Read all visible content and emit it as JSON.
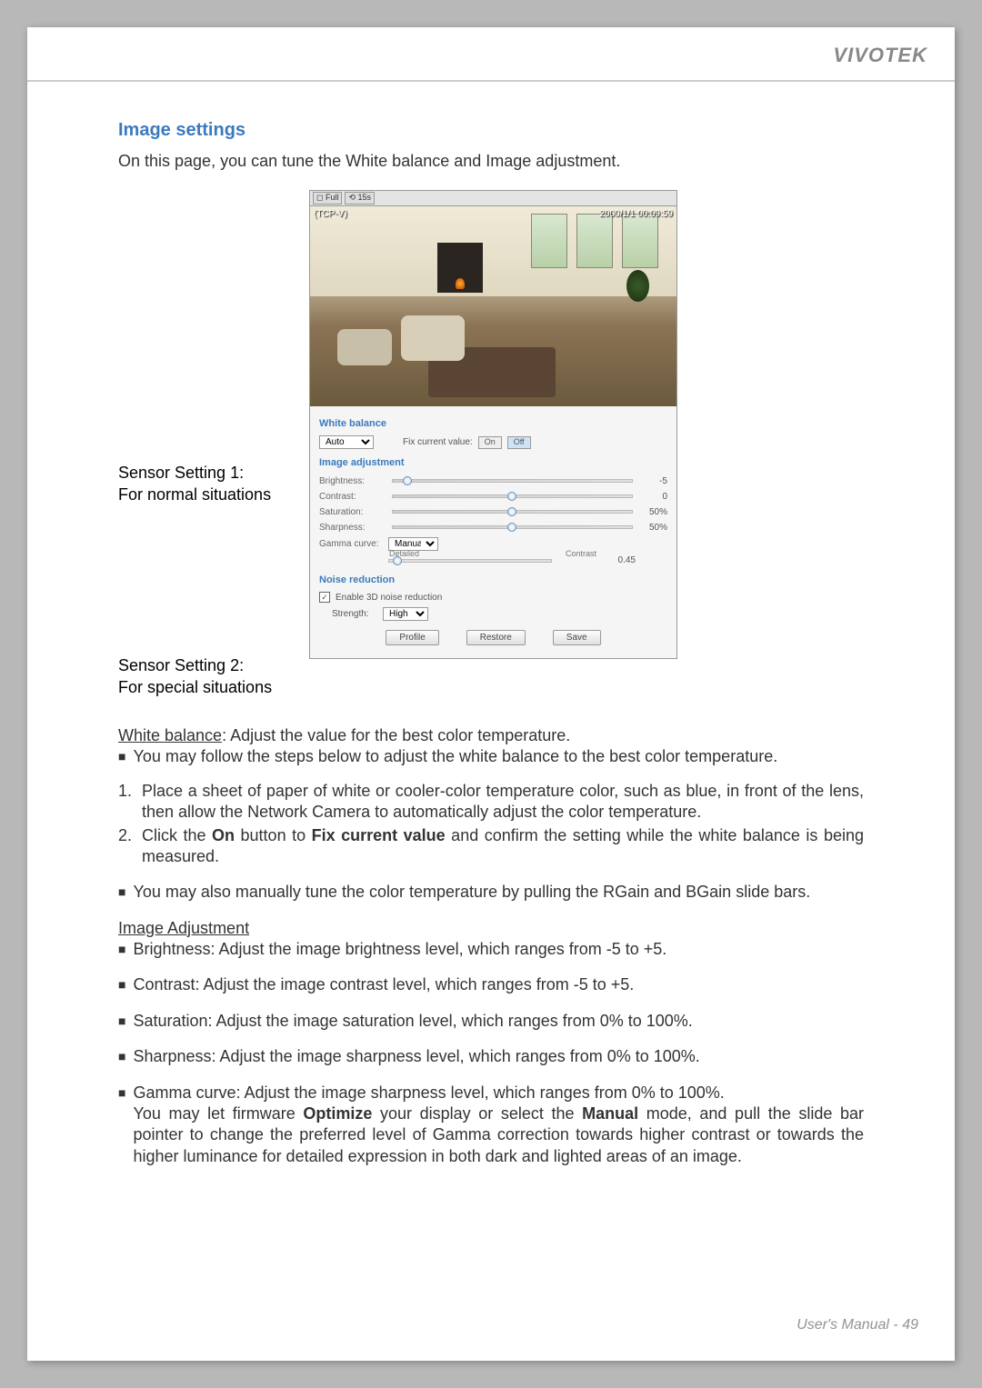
{
  "header": {
    "brand": "VIVOTEK"
  },
  "section": {
    "title": "Image settings",
    "intro": "On this page, you can tune the White balance and Image adjustment."
  },
  "sidebar": {
    "setting1_title": "Sensor Setting 1:",
    "setting1_desc": "For normal situations",
    "setting2_title": "Sensor Setting 2:",
    "setting2_desc": "For special situations"
  },
  "preview": {
    "osd_label": "(TCP-V)",
    "timestamp": "2000/1/1 00:09:59",
    "topbuttons": [
      "◻ Full",
      "⟲ 15s"
    ]
  },
  "whitebalance": {
    "title": "White balance",
    "mode_label": "Auto",
    "fix_label": "Fix current value:",
    "on": "On",
    "off": "Off"
  },
  "image_adj": {
    "title": "Image adjustment",
    "rows": [
      {
        "label": "Brightness:",
        "value": "-5",
        "pos": 5
      },
      {
        "label": "Contrast:",
        "value": "0",
        "pos": 50
      },
      {
        "label": "Saturation:",
        "value": "50%",
        "pos": 50
      },
      {
        "label": "Sharpness:",
        "value": "50%",
        "pos": 50
      }
    ],
    "gamma_label": "Gamma curve:",
    "gamma_mode": "Manual",
    "gamma_left": "Detailed",
    "gamma_right": "Contrast",
    "gamma_value": "0.45"
  },
  "noise": {
    "title": "Noise reduction",
    "enable_label": "Enable 3D noise reduction",
    "checked": true,
    "strength_label": "Strength:",
    "strength_value": "High"
  },
  "buttons": {
    "profile": "Profile",
    "restore": "Restore",
    "save": "Save"
  },
  "body": {
    "wb_head": "White balance",
    "wb_head_rest": ": Adjust the value for the best color temperature.",
    "wb_b1": "You may follow the steps below to adjust the white balance to the best color temperature.",
    "ol1_a": "Place a sheet of paper of white or cooler-color temperature color, such as blue, in front of the lens, then allow the Network Camera to automatically adjust the color temperature.",
    "ol2_pre": "Click the ",
    "ol2_on": "On",
    "ol2_mid": " button to ",
    "ol2_fix": "Fix current value",
    "ol2_post": " and confirm the setting while the white balance is being measured.",
    "wb_b2": "You may also manually tune the color temperature by pulling the RGain and BGain slide bars.",
    "ia_head": "Image Adjustment",
    "ia_b1": "Brightness: Adjust the image brightness level, which ranges from -5 to +5.",
    "ia_b2": "Contrast: Adjust the image contrast level, which ranges from -5 to +5.",
    "ia_b3": "Saturation: Adjust the image saturation level, which ranges from 0% to 100%.",
    "ia_b4": "Sharpness: Adjust the image sharpness level, which ranges from 0% to 100%.",
    "gc_pre": "Gamma curve: Adjust the image sharpness level, which ranges from 0% to 100%.",
    "gc_l1a": "You may let firmware ",
    "gc_opt": "Optimize",
    "gc_l1b": " your display or select the ",
    "gc_man": "Manual",
    "gc_l1c": " mode, and pull the slide bar pointer to change the preferred level of Gamma correction towards higher contrast or towards the higher luminance for detailed expression in both dark and lighted areas of an image."
  },
  "footer": {
    "label": "User's Manual - ",
    "page": "49"
  }
}
